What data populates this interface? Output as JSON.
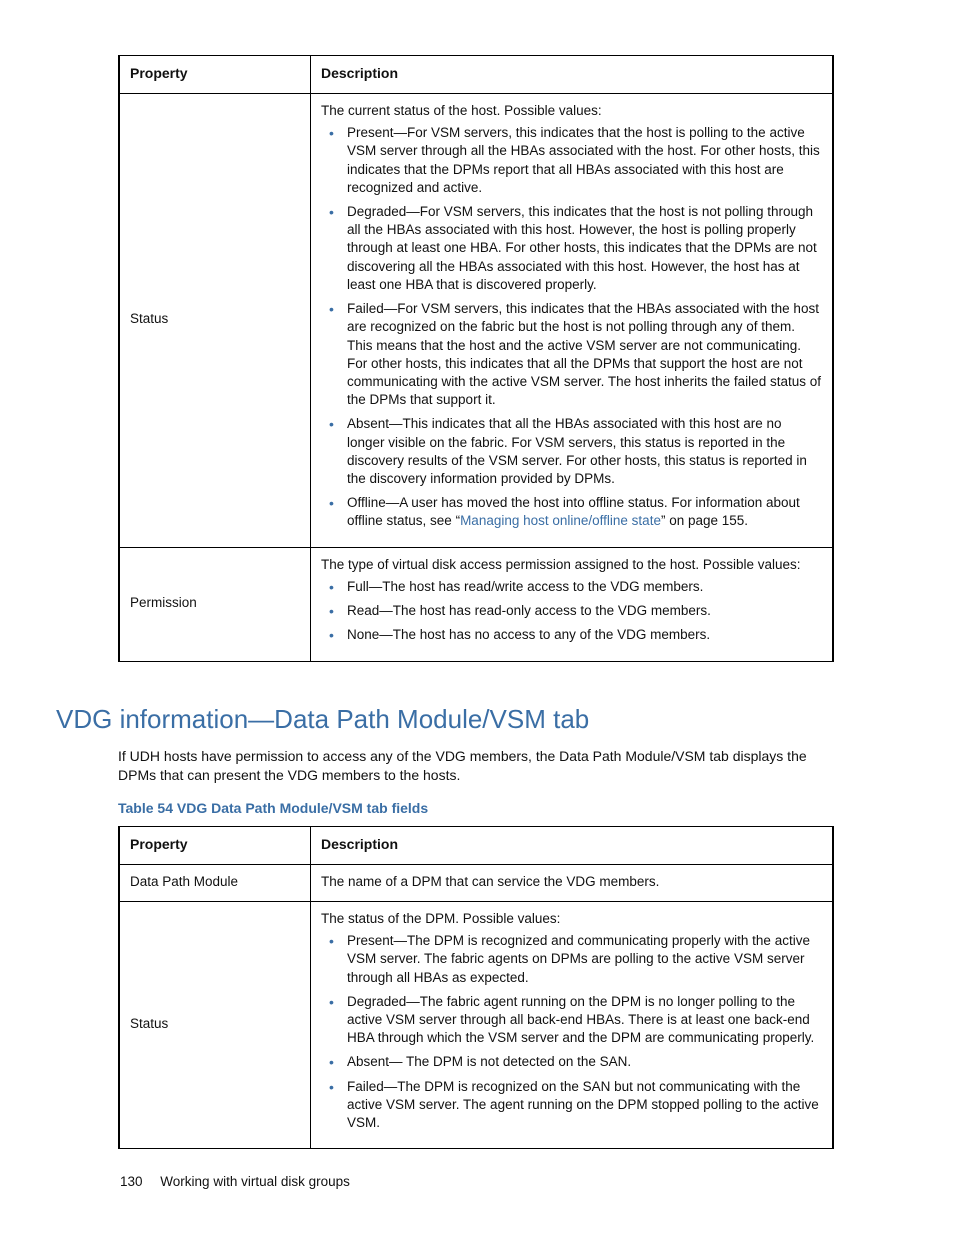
{
  "table1": {
    "headers": {
      "property": "Property",
      "description": "Description"
    },
    "rows": [
      {
        "property": "Status",
        "intro": "The current status of the host. Possible values:",
        "bullets": [
          "Present—For VSM servers, this indicates that the host is polling to the active VSM server through all the HBAs associated with the host. For other hosts, this indicates that the DPMs report that all HBAs associated with this host are recognized and active.",
          "Degraded—For VSM servers, this indicates that the host is not polling through all the HBAs associated with this host. However, the host is polling properly through at least one HBA. For other hosts, this indicates that the DPMs are not discovering all the HBAs associated with this host. However, the host has at least one HBA that is discovered properly.",
          "Failed—For VSM servers, this indicates that the HBAs associated with the host are recognized on the fabric but the host is not polling through any of them. This means that the host and the active VSM server are not communicating. For other hosts, this indicates that all the DPMs that support the host are not communicating with the active VSM server. The host inherits the failed status of the DPMs that support it.",
          "Absent—This indicates that all the HBAs associated with this host are no longer visible on the fabric. For VSM servers, this status is reported in the discovery results of the VSM server. For other hosts, this status is reported in the discovery information provided by DPMs."
        ],
        "bullet_offline_pre": "Offline—A user has moved the host into offline status. For information about offline status, see “",
        "bullet_offline_link": "Managing host online/offline state",
        "bullet_offline_post": "” on page 155."
      },
      {
        "property": "Permission",
        "intro": "The type of virtual disk access permission assigned to the host. Possible values:",
        "bullets": [
          "Full—The host has read/write access to the VDG members.",
          "Read—The host has read-only access to the VDG members.",
          "None—The host has no access to any of the VDG members."
        ]
      }
    ]
  },
  "section": {
    "title": "VDG information—Data Path Module/VSM tab",
    "body": "If UDH hosts have permission to access any of the VDG members, the Data Path Module/VSM tab displays the DPMs that can present the VDG members to the hosts.",
    "caption": "Table 54 VDG Data Path Module/VSM tab fields"
  },
  "table2": {
    "headers": {
      "property": "Property",
      "description": "Description"
    },
    "rows": [
      {
        "property": "Data Path Module",
        "plain": "The name of a DPM that can service the VDG members."
      },
      {
        "property": "Status",
        "intro": "The status of the DPM. Possible values:",
        "bullets": [
          "Present—The DPM is recognized and communicating properly with the active VSM server. The fabric agents on DPMs are polling to the active VSM server through all HBAs as expected.",
          "Degraded—The fabric agent running on the DPM is no longer polling to the active VSM server through all back-end HBAs. There is at least one back-end HBA through which the VSM server and the DPM are communicating properly.",
          "Absent— The DPM is not detected on the SAN.",
          "Failed—The DPM is recognized on the SAN but not communicating with the active VSM server. The agent running on the DPM stopped polling to the active VSM."
        ]
      }
    ]
  },
  "footer": {
    "page": "130",
    "chapter": "Working with virtual disk groups"
  }
}
